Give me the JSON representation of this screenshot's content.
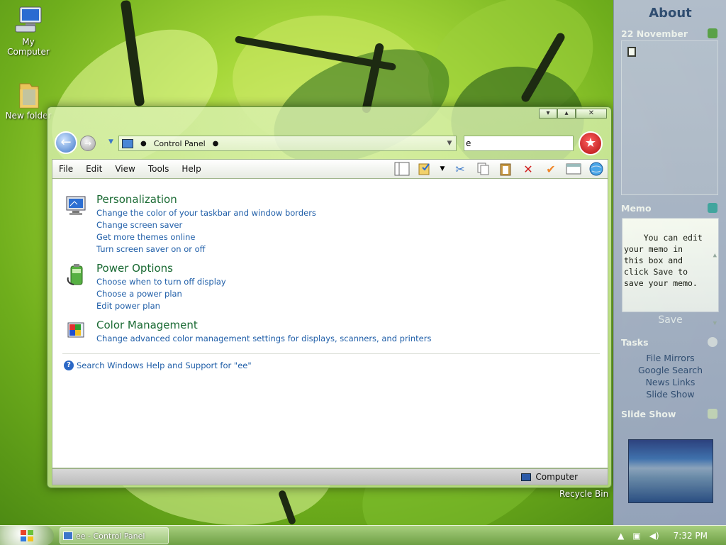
{
  "desktop": {
    "icons": [
      {
        "label": "My Computer"
      },
      {
        "label": "New folder"
      }
    ],
    "recycle_bin": "Recycle Bin"
  },
  "window": {
    "title": "ee - Control Panel",
    "address": "Control Panel",
    "search_value": "e",
    "menu": [
      "File",
      "Edit",
      "View",
      "Tools",
      "Help"
    ],
    "categories": [
      {
        "title": "Personalization",
        "icon": "monitor-icon",
        "links": [
          "Change the color of your taskbar and window borders",
          "Change screen saver",
          "Get more themes online",
          "Turn screen saver on or off"
        ]
      },
      {
        "title": "Power Options",
        "icon": "battery-icon",
        "links": [
          "Choose when to turn off display",
          "Choose a power plan",
          "Edit power plan"
        ]
      },
      {
        "title": "Color Management",
        "icon": "color-management-icon",
        "links": [
          "Change advanced color management settings for displays, scanners, and printers"
        ]
      }
    ],
    "help_link": "Search Windows Help and Support for \"ee\"",
    "status": "Computer"
  },
  "sidebar": {
    "title": "About",
    "date": "22 November",
    "memo_heading": "Memo",
    "memo_text": "You can edit your memo in this box and click Save to save your memo.",
    "save_label": "Save",
    "tasks_heading": "Tasks",
    "tasks": [
      "File Mirrors",
      "Google Search",
      "News Links",
      "Slide Show"
    ],
    "slideshow_heading": "Slide Show"
  },
  "taskbar": {
    "time": "7:32 PM"
  },
  "colors": {
    "link": "#1f5ea8",
    "category_title": "#1a6a33",
    "sidebar_title": "#2d4878"
  }
}
